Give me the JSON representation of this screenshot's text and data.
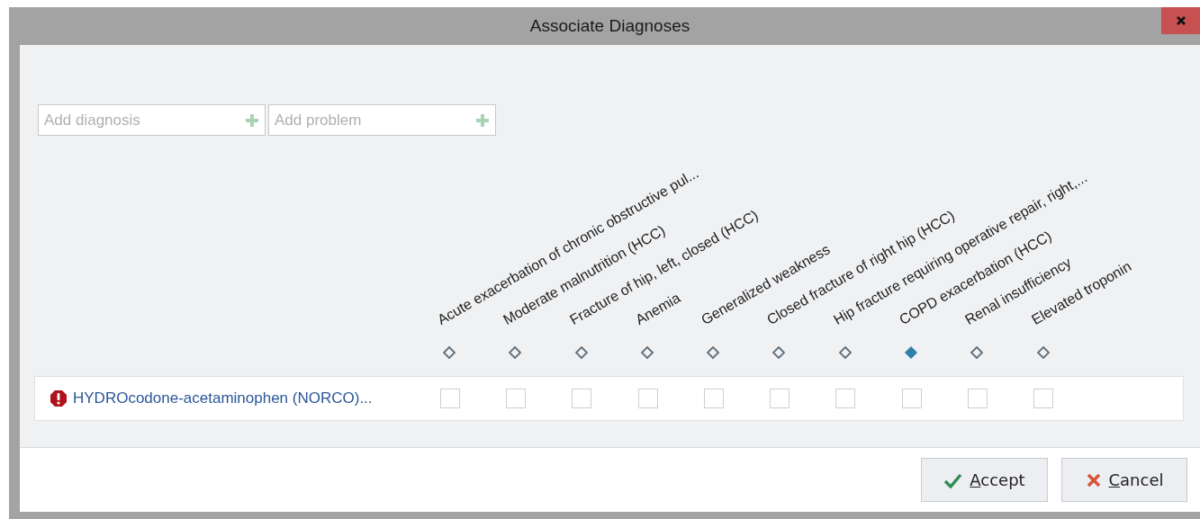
{
  "window": {
    "title": "Associate Diagnoses"
  },
  "fields": [
    {
      "placeholder": "Add diagnosis"
    },
    {
      "placeholder": "Add problem"
    }
  ],
  "diagnoses": [
    {
      "label": "Acute exacerbation of chronic obstructive pul...",
      "selected": false
    },
    {
      "label": "Moderate malnutrition (HCC)",
      "selected": false
    },
    {
      "label": "Fracture of hip, left, closed (HCC)",
      "selected": false
    },
    {
      "label": "Anemia",
      "selected": false
    },
    {
      "label": "Generalized weakness",
      "selected": false
    },
    {
      "label": "Closed fracture of right hip (HCC)",
      "selected": false
    },
    {
      "label": "Hip fracture requiring operative repair, right,...",
      "selected": false
    },
    {
      "label": "COPD exacerbation (HCC)",
      "selected": true
    },
    {
      "label": "Renal insufficiency",
      "selected": false
    },
    {
      "label": "Elevated troponin",
      "selected": false
    }
  ],
  "rows": [
    {
      "name": "HYDROcodone-acetaminophen (NORCO)...",
      "alert": true,
      "cells": [
        {
          "checked": false
        },
        {
          "checked": false
        },
        {
          "checked": false
        },
        {
          "checked": false
        },
        {
          "checked": false
        },
        {
          "checked": false
        },
        {
          "checked": false
        },
        {
          "checked": false
        },
        {
          "checked": false
        },
        {
          "checked": false
        }
      ]
    }
  ],
  "buttons": [
    {
      "label": "Accept",
      "kind": "accept"
    },
    {
      "label": "Cancel",
      "kind": "cancel"
    }
  ]
}
